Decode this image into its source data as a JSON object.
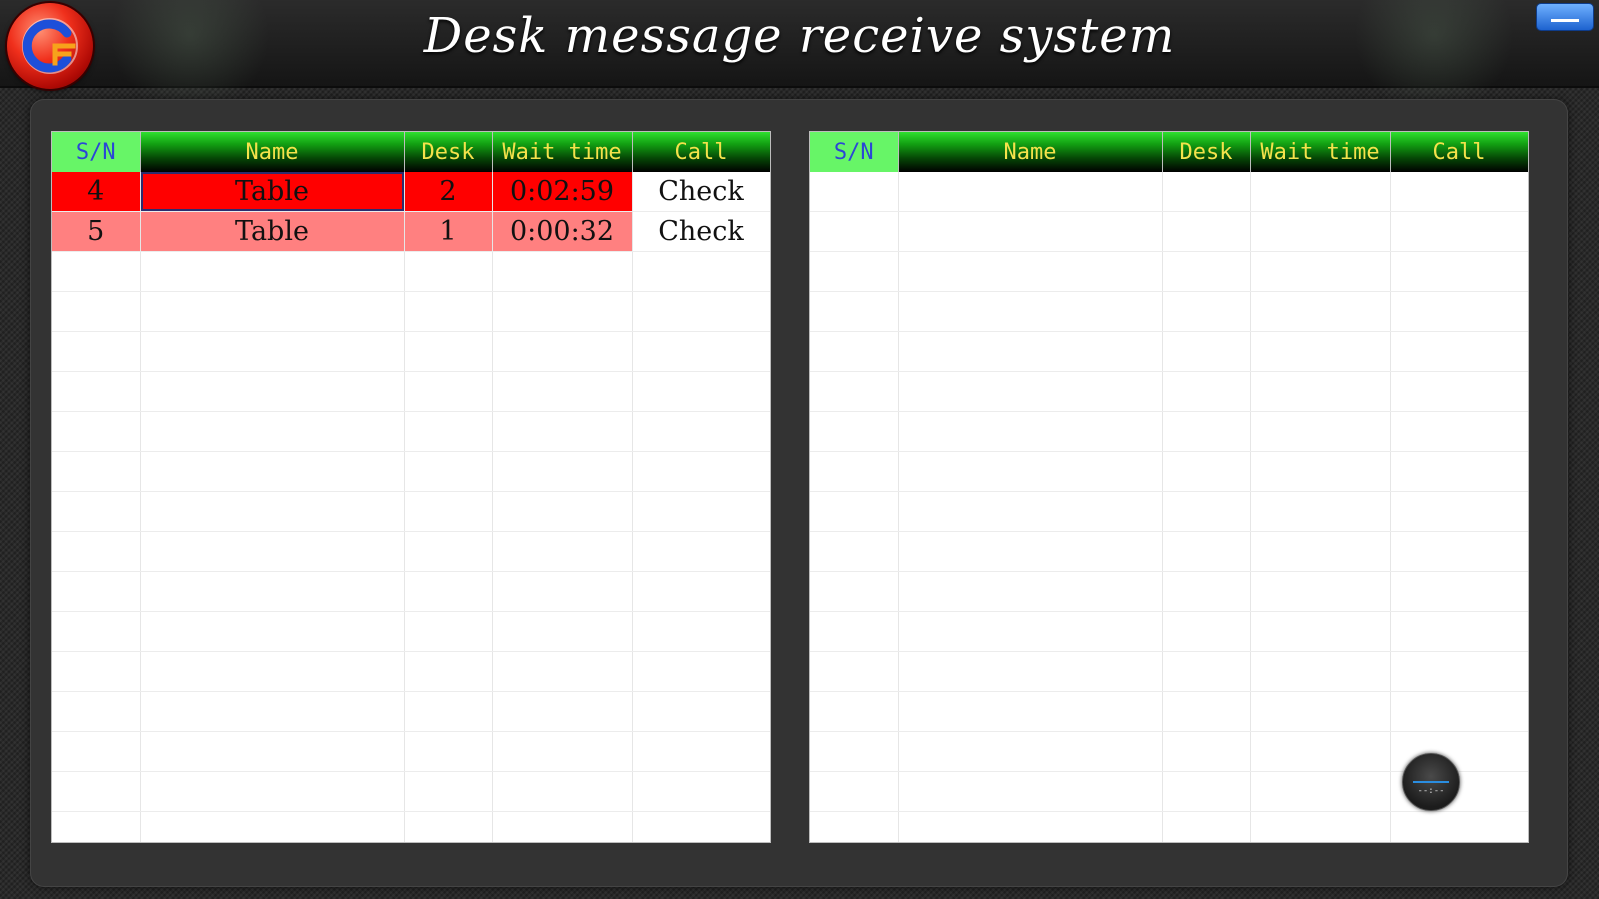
{
  "app": {
    "title": "Desk message receive system",
    "logo_text": "CF",
    "minimize_label": ""
  },
  "columns": [
    "S/N",
    "Name",
    "Desk",
    "Wait time",
    "Call"
  ],
  "left_table": {
    "rows": [
      {
        "sn": "4",
        "name": "Table",
        "desk": "2",
        "wait_time": "0:02:59",
        "call": "Check",
        "status_color": "#ff0000"
      },
      {
        "sn": "5",
        "name": "Table",
        "desk": "1",
        "wait_time": "0:00:32",
        "call": "Check",
        "status_color": "#ff8080"
      }
    ]
  },
  "right_table": {
    "rows": []
  },
  "timer_widget": {
    "text": "--:--"
  },
  "colors": {
    "header_text": "#f4e24b",
    "sn_header_bg": "#67f567",
    "sn_header_text": "#2b46d6",
    "row_alert": "#ff0000",
    "row_warning": "#ff8080",
    "background": "#2a2a2a"
  }
}
